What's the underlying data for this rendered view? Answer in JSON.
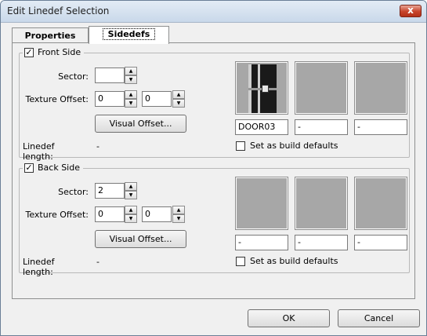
{
  "window": {
    "title": "Edit Linedef Selection",
    "close_glyph": "x"
  },
  "tabs": [
    {
      "label": "Properties"
    },
    {
      "label": "Sidedefs"
    }
  ],
  "labels": {
    "sector": "Sector:",
    "texture_offset": "Texture Offset:",
    "visual_offset": "Visual Offset...",
    "linedef_length": "Linedef length:",
    "build_defaults": "Set as build defaults"
  },
  "front_side": {
    "title": "Front Side",
    "checked": true,
    "sector": "",
    "offset_x": "0",
    "offset_y": "0",
    "linedef_length": "-",
    "textures": [
      "DOOR03",
      "-",
      "-"
    ],
    "build_defaults": false
  },
  "back_side": {
    "title": "Back Side",
    "checked": true,
    "sector": "2",
    "offset_x": "0",
    "offset_y": "0",
    "linedef_length": "-",
    "textures": [
      "-",
      "-",
      "-"
    ],
    "build_defaults": false
  },
  "footer": {
    "ok": "OK",
    "cancel": "Cancel"
  },
  "spin": {
    "up": "▲",
    "down": "▼"
  },
  "check_glyph": "✓"
}
